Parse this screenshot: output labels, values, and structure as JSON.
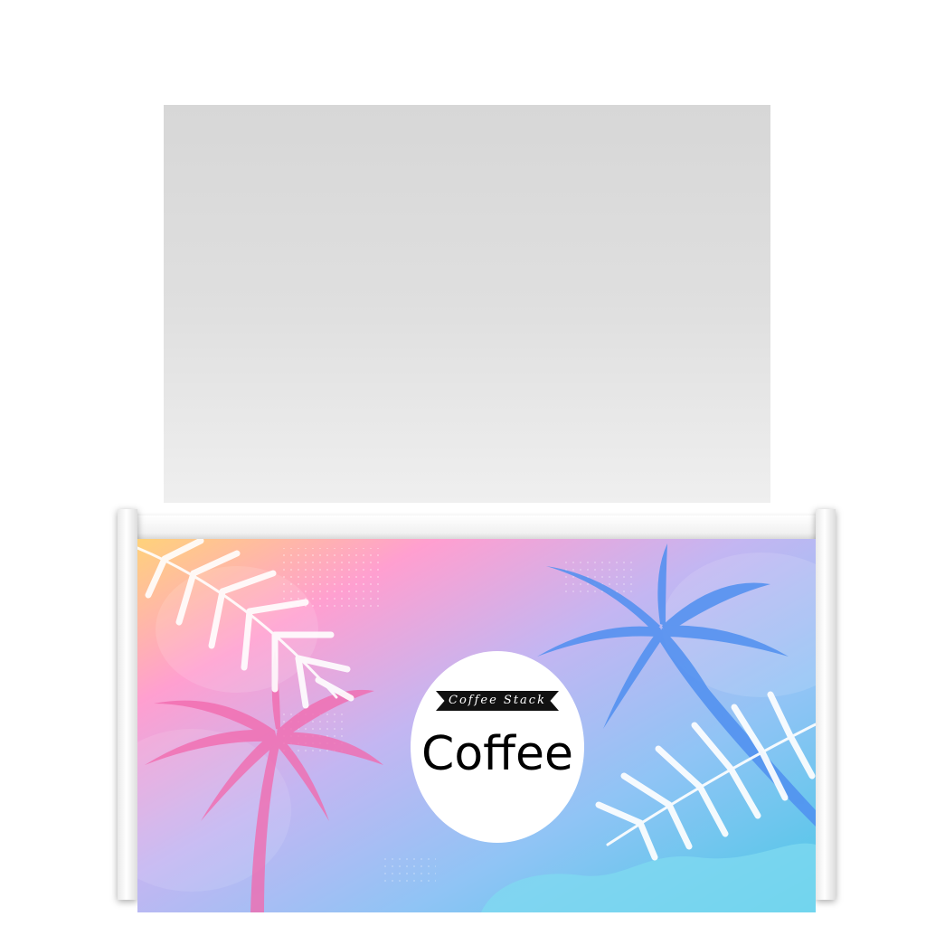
{
  "badge": {
    "tagline": "Coffee Stack",
    "title": "Coffee"
  },
  "colors": {
    "sign_panel": "#dcdcdc",
    "counter_frame": "#ffffff",
    "badge_background": "#ffffff",
    "ribbon": "#111111",
    "title_text": "#000000",
    "gradient": [
      "#ffd27a",
      "#ff9fd0",
      "#c3b6f2",
      "#8fc4f5",
      "#4bc8e6"
    ],
    "palm_pink": "#f26aae",
    "palm_blue": "#4f8ff0",
    "leaf_white": "#ffffff"
  },
  "icons": [
    "palm-tree-icon",
    "palm-leaf-icon"
  ]
}
